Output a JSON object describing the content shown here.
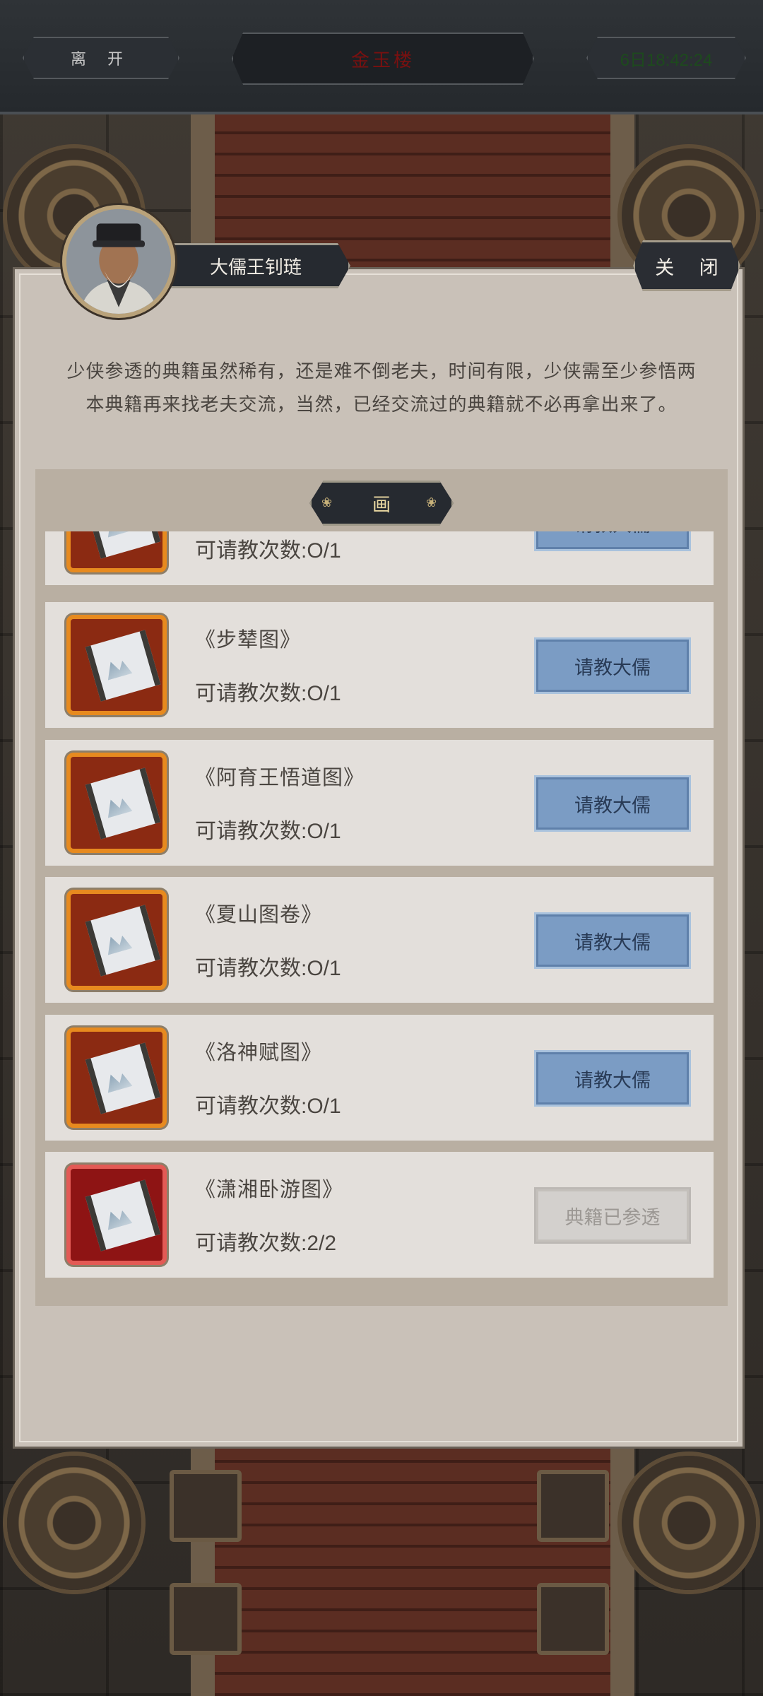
{
  "topbar": {
    "leave_label": "离 开",
    "location_title": "金玉楼",
    "timer": "6日18:42:24"
  },
  "dialog": {
    "npc_name": "大儒王钊琏",
    "close_label": "关 闭",
    "description": "少侠参透的典籍虽然稀有，还是难不倒老夫，时间有限，少侠需至少参悟两本典籍再来找老夫交流，当然，已经交流过的典籍就不必再拿出来了。",
    "category_label": "画"
  },
  "books": [
    {
      "name": "",
      "count": "可请教次数:O/1",
      "button": "请教大儒",
      "state": "available"
    },
    {
      "name": "《步辇图》",
      "count": "可请教次数:O/1",
      "button": "请教大儒",
      "state": "available"
    },
    {
      "name": "《阿育王悟道图》",
      "count": "可请教次数:O/1",
      "button": "请教大儒",
      "state": "available"
    },
    {
      "name": "《夏山图卷》",
      "count": "可请教次数:O/1",
      "button": "请教大儒",
      "state": "available"
    },
    {
      "name": "《洛神赋图》",
      "count": "可请教次数:O/1",
      "button": "请教大儒",
      "state": "available"
    },
    {
      "name": "《潇湘卧游图》",
      "count": "可请教次数:2/2",
      "button": "典籍已参透",
      "state": "mastered"
    }
  ],
  "colors": {
    "button_blue": "#7b9cc4",
    "icon_orange": "#e78a1f",
    "icon_red": "#e35a55"
  },
  "icons": {
    "book": "scroll-painting-icon"
  }
}
